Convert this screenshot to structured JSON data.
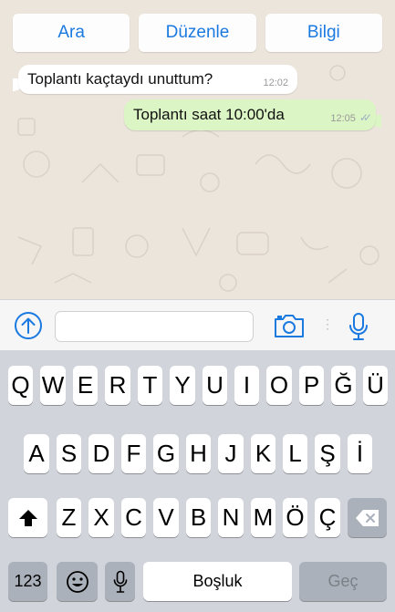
{
  "header_actions": [
    {
      "label": "Ara"
    },
    {
      "label": "Düzenle"
    },
    {
      "label": "Bilgi"
    }
  ],
  "messages": [
    {
      "direction": "incoming",
      "text": "Toplantı kaçtaydı unuttum?",
      "time": "12:02"
    },
    {
      "direction": "outgoing",
      "text": "Toplantı saat 10:00'da",
      "time": "12:05",
      "status": "read-double-check"
    }
  ],
  "input_bar": {
    "attach_icon": "arrow-up-circle-icon",
    "text_value": "",
    "camera_icon": "camera-icon",
    "mic_icon": "microphone-icon"
  },
  "keyboard": {
    "row1": [
      "Q",
      "W",
      "E",
      "R",
      "T",
      "Y",
      "U",
      "I",
      "O",
      "P",
      "Ğ",
      "Ü"
    ],
    "row2": [
      "A",
      "S",
      "D",
      "F",
      "G",
      "H",
      "J",
      "K",
      "L",
      "Ş",
      "İ"
    ],
    "row3": [
      "Z",
      "X",
      "C",
      "V",
      "B",
      "N",
      "M",
      "Ö",
      "Ç"
    ],
    "numbers_label": "123",
    "space_label": "Boşluk",
    "return_label": "Geç",
    "shift_icon": "shift-icon",
    "delete_icon": "backspace-icon",
    "emoji_icon": "emoji-icon",
    "dictation_icon": "microphone-icon"
  },
  "colors": {
    "accent": "#1a7ae0",
    "outgoing_bubble": "#dbf5c4",
    "incoming_bubble": "#ffffff",
    "chat_background": "#ece5dc",
    "keyboard_background": "#d1d5db"
  }
}
